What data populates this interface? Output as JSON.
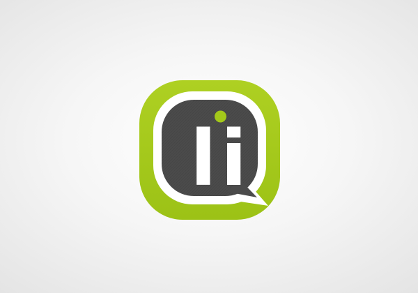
{
  "logo": {
    "text": "li",
    "icon": "speech-bubble-li-icon",
    "colors": {
      "background": "#ececec",
      "outer_tile": "#a3c81a",
      "ring": "#ffffff",
      "bubble": "#4b4b4b",
      "letters": "#ffffff",
      "dot": "#a3c81a"
    }
  }
}
